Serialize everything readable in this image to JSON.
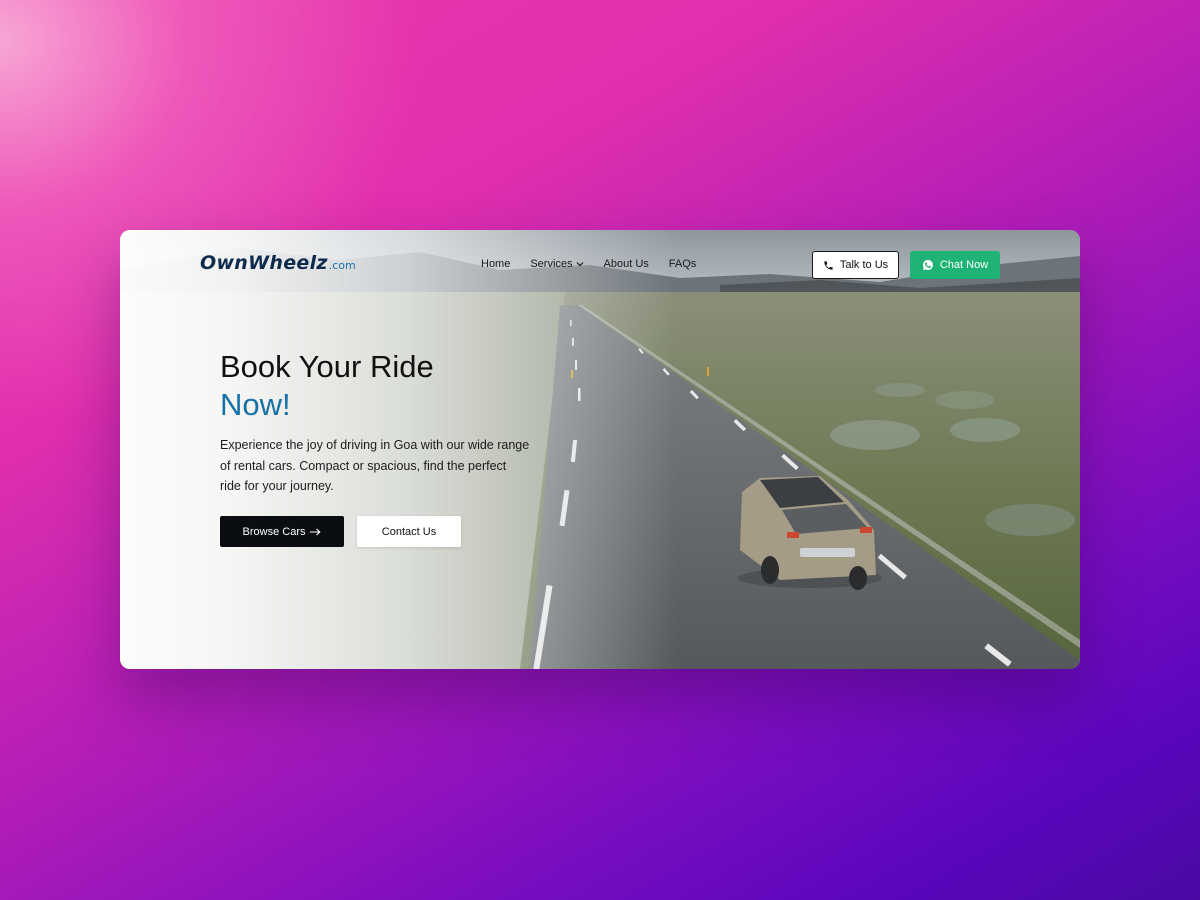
{
  "brand": {
    "logo_main": "OwnWheelz",
    "logo_suffix": ".com",
    "primary_color": "#0f2b4c",
    "accent_color": "#1571a6"
  },
  "nav": {
    "items": [
      {
        "label": "Home"
      },
      {
        "label": "Services",
        "icon": "chevron-down-icon"
      },
      {
        "label": "About Us"
      },
      {
        "label": "FAQs"
      }
    ]
  },
  "actions": {
    "talk_label": "Talk to Us",
    "talk_icon": "phone-icon",
    "chat_label": "Chat Now",
    "chat_icon": "whatsapp-icon",
    "chat_color": "#1fb476"
  },
  "hero": {
    "title_line1": "Book Your Ride",
    "title_line2": "Now!",
    "description": "Experience the joy of driving in Goa with our wide range of rental cars. Compact or spacious, find the perfect ride for your journey.",
    "browse_label": "Browse Cars",
    "browse_icon": "arrow-right-icon",
    "contact_label": "Contact Us"
  }
}
